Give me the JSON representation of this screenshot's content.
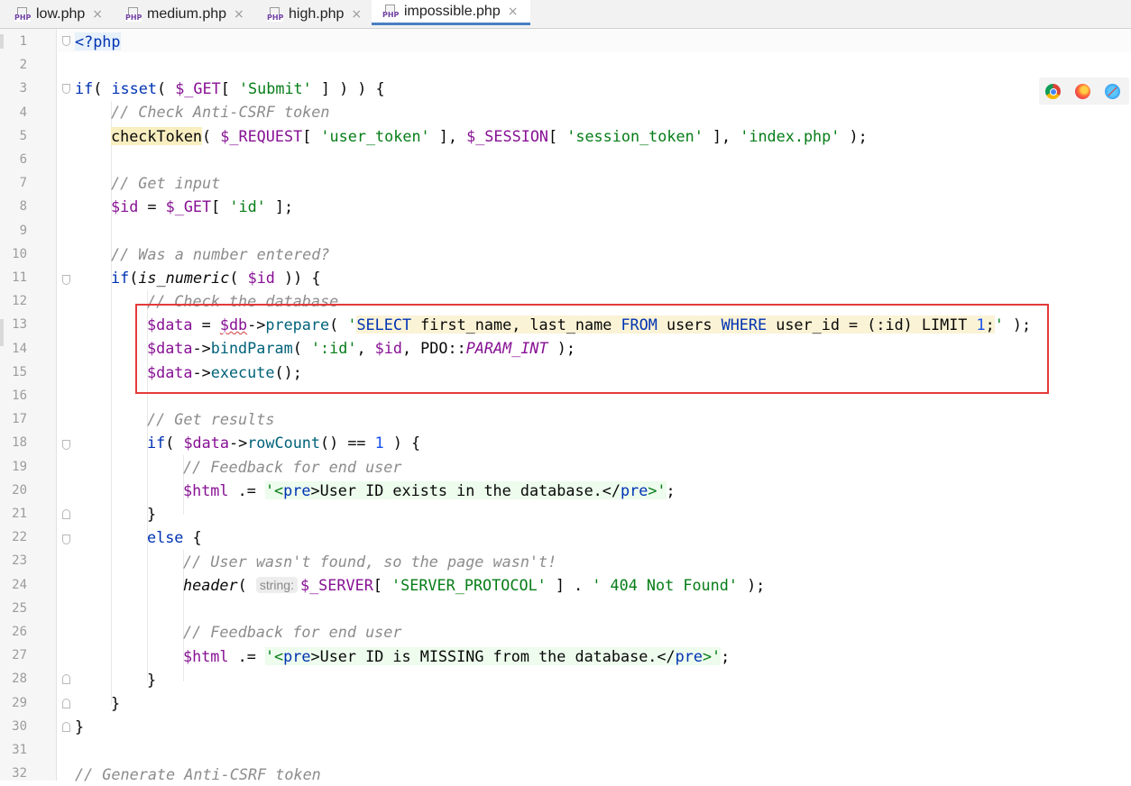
{
  "tabs": [
    {
      "label": "low.php",
      "icon": "php-file-icon",
      "active": false
    },
    {
      "label": "medium.php",
      "icon": "php-file-icon",
      "active": false
    },
    {
      "label": "high.php",
      "icon": "php-file-icon",
      "active": false
    },
    {
      "label": "impossible.php",
      "icon": "php-file-icon",
      "active": true
    }
  ],
  "php_icon_label": "PHP",
  "tab_close_glyph": "×",
  "line_numbers": [
    "1",
    "2",
    "3",
    "4",
    "5",
    "6",
    "7",
    "8",
    "9",
    "10",
    "11",
    "12",
    "13",
    "14",
    "15",
    "16",
    "17",
    "18",
    "19",
    "20",
    "21",
    "22",
    "23",
    "24",
    "25",
    "26",
    "27",
    "28",
    "29",
    "30",
    "31",
    "32"
  ],
  "code": {
    "l1": "<?php",
    "l3": [
      "if",
      "( ",
      "isset",
      "( ",
      "$_GET",
      "[ ",
      "'Submit'",
      " ] ) ) {"
    ],
    "l4": "// Check Anti-CSRF token",
    "l5": [
      "checkToken",
      "( ",
      "$_REQUEST",
      "[ ",
      "'user_token'",
      " ], ",
      "$_SESSION",
      "[ ",
      "'session_token'",
      " ], ",
      "'index.php'",
      " );"
    ],
    "l7": "// Get input",
    "l8": [
      "$id",
      " = ",
      "$_GET",
      "[ ",
      "'id'",
      " ];"
    ],
    "l10": "// Was a number entered?",
    "l11": [
      "if",
      "(",
      "is_numeric",
      "( ",
      "$id",
      " )) {"
    ],
    "l12": "// Check the database",
    "l13": [
      "$data",
      " = ",
      "$db",
      "->",
      "prepare",
      "( ",
      "'",
      "SELECT",
      " first_name, last_name ",
      "FROM",
      " users ",
      "WHERE",
      " user_id = (:id) LIMIT ",
      "1",
      ";",
      "'",
      " );"
    ],
    "l14": [
      "$data",
      "->",
      "bindParam",
      "( ",
      "':id'",
      ", ",
      "$id",
      ", PDO::",
      "PARAM_INT",
      " );"
    ],
    "l15": [
      "$data",
      "->",
      "execute",
      "();"
    ],
    "l17": "// Get results",
    "l18": [
      "if",
      "( ",
      "$data",
      "->",
      "rowCount",
      "() == ",
      "1",
      " ) {"
    ],
    "l19": "// Feedback for end user",
    "l20": [
      "$html",
      " .= ",
      "'<",
      "pre",
      ">User ID exists in the database.</",
      "pre",
      ">'",
      ";"
    ],
    "l21": "}",
    "l22": [
      "else",
      " {"
    ],
    "l23": "// User wasn't found, so the page wasn't!",
    "l24": [
      "header",
      "( ",
      "string:",
      "$_SERVER",
      "[ ",
      "'SERVER_PROTOCOL'",
      " ] . ",
      "' 404 Not Found'",
      " );"
    ],
    "l26": "// Feedback for end user",
    "l27": [
      "$html",
      " .= ",
      "'<",
      "pre",
      ">User ID is MISSING from the database.</",
      "pre",
      ">'",
      ";"
    ],
    "l28": "}",
    "l29": "}",
    "l30": "}",
    "l32": "// Generate Anti-CSRF token"
  },
  "browsers": [
    "chrome-icon",
    "firefox-icon",
    "safari-icon"
  ],
  "colors": {
    "keyword": "#0033b3",
    "comment": "#8c8c8c",
    "string": "#067d17",
    "variable": "#871094",
    "function": "#00627a",
    "highlight_box": "#e53a3a",
    "active_tab_underline": "#4a7fc1"
  }
}
